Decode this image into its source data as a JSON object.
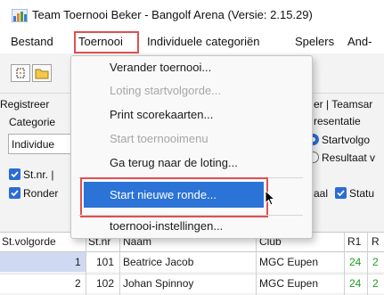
{
  "window": {
    "title": "Team Toernooi Beker - Bangolf Arena (Versie: 2.15.29)",
    "icon": "app-chart-icon"
  },
  "menubar": {
    "items": [
      "Bestand",
      "Toernooi",
      "Individuele categoriën",
      "Spelers",
      "And-"
    ],
    "active": "Toernooi"
  },
  "toolbar": {
    "icons": [
      "new-document-icon",
      "open-folder-icon"
    ]
  },
  "left_panel": {
    "tab_label": "Registreer",
    "category_label": "Categorie",
    "category_value": "Individue",
    "checkbox_stnr": "St.nr. |",
    "checkbox_ronde": "Ronder"
  },
  "right_panel": {
    "tab_text": "er | Teamsar",
    "presentation_label": "resentatie",
    "radio_start": "Startvolgo",
    "radio_result": "Resultaat v",
    "checkbox_aal": "aal",
    "checkbox_status": "Statu"
  },
  "dropdown": {
    "items": [
      {
        "label": "Verander toernooi...",
        "enabled": true
      },
      {
        "label": "Loting startvolgorde...",
        "enabled": false
      },
      {
        "label": "Print scorekaarten...",
        "enabled": true
      },
      {
        "label": "Start toernooimenu",
        "enabled": false
      },
      {
        "label": "Ga terug naar de loting...",
        "enabled": true
      },
      {
        "label": "Start nieuwe ronde...",
        "enabled": true,
        "highlighted": true
      },
      {
        "label": "toernooi-instellingen...",
        "enabled": true
      }
    ]
  },
  "table": {
    "headers": [
      "St.volgorde",
      "St.nr",
      "Naam",
      "Club",
      "R1",
      "R"
    ],
    "rows": [
      {
        "volgorde": "1",
        "stnr": "101",
        "naam": "Beatrice Jacob",
        "club": "MGC Eupen",
        "r1": "24",
        "r": "2"
      },
      {
        "volgorde": "2",
        "stnr": "102",
        "naam": "Johan Spinnoy",
        "club": "MGC Eupen",
        "r1": "24",
        "r": "2"
      }
    ]
  },
  "colors": {
    "accent": "#2b73d6",
    "highlight_frame": "#e05050",
    "score_green": "#1e9e1e",
    "row_selected": "#cfdaf2"
  }
}
